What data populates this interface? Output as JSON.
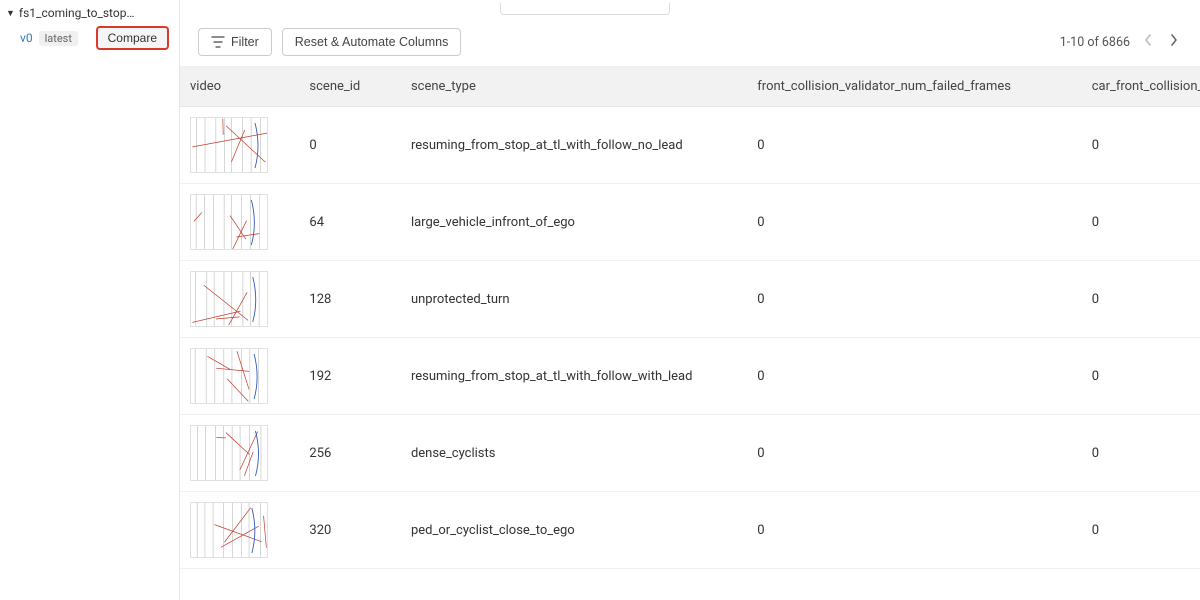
{
  "sidebar": {
    "node_name": "fs1_coming_to_stop…",
    "version_tag": "v0",
    "latest_label": "latest",
    "compare_label": "Compare"
  },
  "toolbar": {
    "filter_label": "Filter",
    "reset_label": "Reset & Automate Columns"
  },
  "pagination": {
    "text": "1-10 of 6866"
  },
  "columns": {
    "video": "video",
    "scene_id": "scene_id",
    "scene_type": "scene_type",
    "front_collision": "front_collision_validator_num_failed_frames",
    "car_front_collision": "car_front_collision_validator_num_failed_fr"
  },
  "rows": [
    {
      "scene_id": "0",
      "scene_type": "resuming_from_stop_at_tl_with_follow_no_lead",
      "fc": "0",
      "cfc": "0"
    },
    {
      "scene_id": "64",
      "scene_type": "large_vehicle_infront_of_ego",
      "fc": "0",
      "cfc": "0"
    },
    {
      "scene_id": "128",
      "scene_type": "unprotected_turn",
      "fc": "0",
      "cfc": "0"
    },
    {
      "scene_id": "192",
      "scene_type": "resuming_from_stop_at_tl_with_follow_with_lead",
      "fc": "0",
      "cfc": "0"
    },
    {
      "scene_id": "256",
      "scene_type": "dense_cyclists",
      "fc": "0",
      "cfc": "0"
    },
    {
      "scene_id": "320",
      "scene_type": "ped_or_cyclist_close_to_ego",
      "fc": "0",
      "cfc": "0"
    }
  ]
}
